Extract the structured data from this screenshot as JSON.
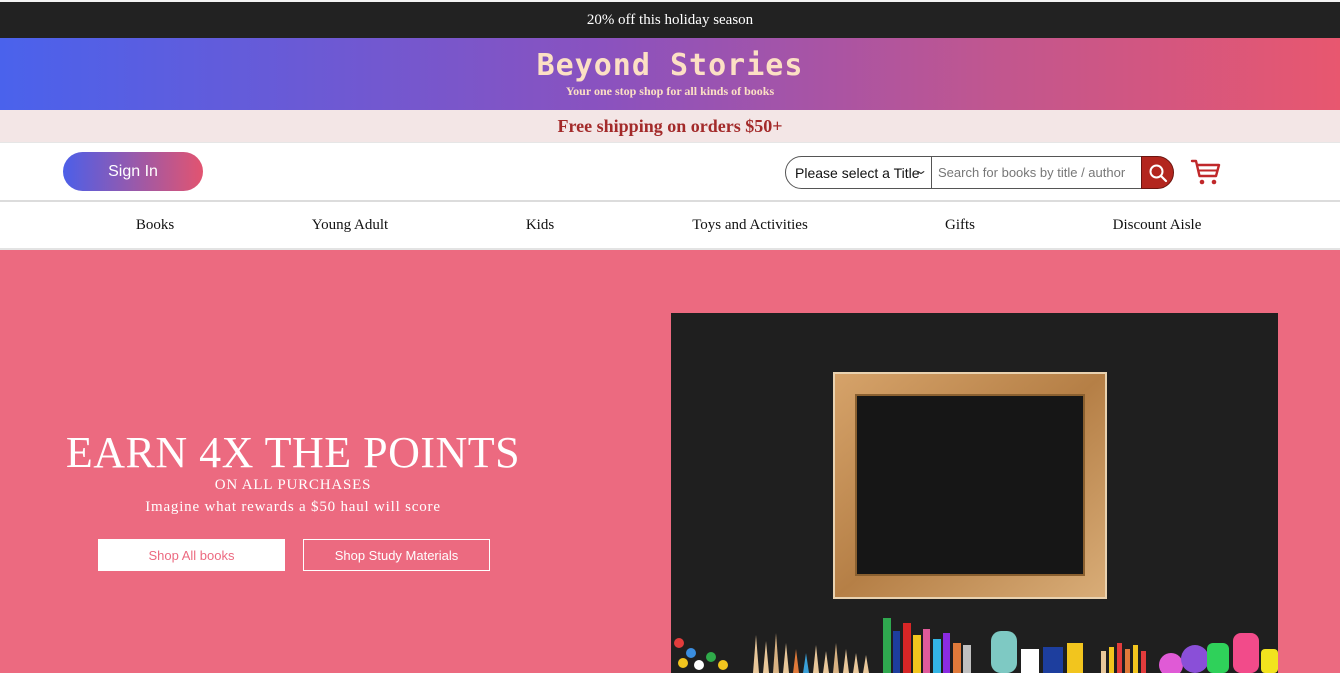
{
  "promo": {
    "text": "20% off this holiday season"
  },
  "brand": {
    "name": "Beyond Stories",
    "tagline": "Your one stop shop for all kinds of books"
  },
  "shipping": {
    "text": "Free shipping on orders $50+"
  },
  "toolbar": {
    "sign_in_label": "Sign In",
    "title_select": {
      "selected": "Please select a Title"
    },
    "search": {
      "placeholder": "Search for books by title / author",
      "value": ""
    }
  },
  "nav": {
    "items": [
      "Books",
      "Young Adult",
      "Kids",
      "Toys and Activities",
      "Gifts",
      "Discount Aisle"
    ]
  },
  "hero": {
    "headline": "EARN 4X THE POINTS",
    "sub1": "ON ALL PURCHASES",
    "sub2": "Imagine what rewards a $50 haul will score",
    "button_all": "Shop All books",
    "button_study": "Shop Study Materials"
  },
  "colors": {
    "promo_bg": "#222222",
    "brand_gradient_start": "#4a62ec",
    "brand_gradient_end": "#e8576f",
    "brand_text": "#fce0c4",
    "shipping_text": "#a32a2a",
    "search_button": "#b3261e",
    "hero_bg": "#ec6a80"
  },
  "icons": {
    "search": "search-icon",
    "cart": "cart-icon",
    "dropdown": "chevron-down-icon"
  }
}
